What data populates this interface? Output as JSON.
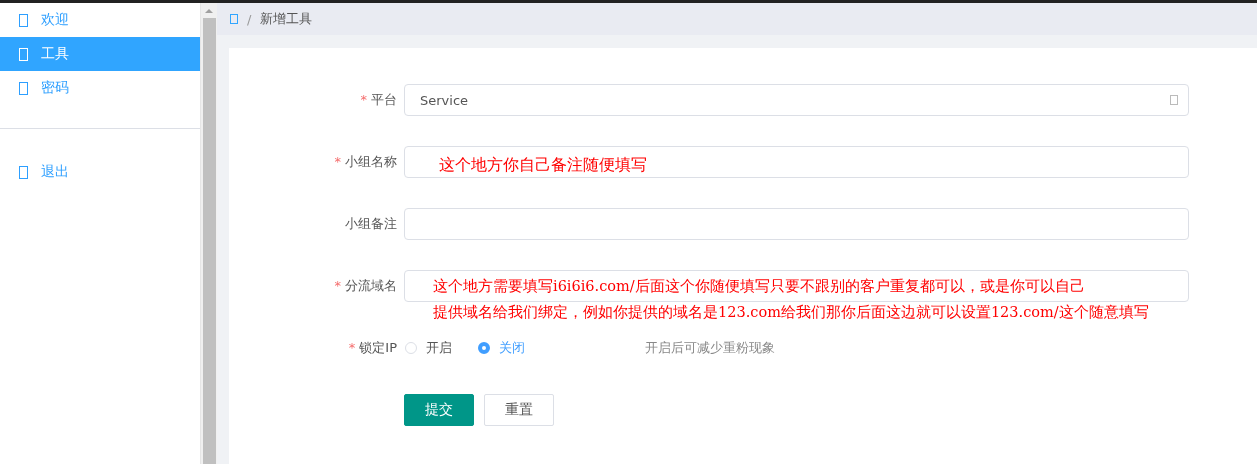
{
  "sidebar": {
    "items": [
      {
        "label": "欢迎",
        "selected": false
      },
      {
        "label": "工具",
        "selected": true
      },
      {
        "label": "密码",
        "selected": false
      }
    ],
    "logout": "退出"
  },
  "breadcrumb": {
    "separator": "/",
    "current": "新增工具"
  },
  "form": {
    "required_mark": "*",
    "fields": [
      {
        "kind": "select",
        "label": "平台",
        "required": true,
        "value": "Service"
      },
      {
        "kind": "text",
        "label": "小组名称",
        "required": true
      },
      {
        "kind": "text",
        "label": "小组备注",
        "required": false
      },
      {
        "kind": "text",
        "label": "分流域名",
        "required": true
      },
      {
        "kind": "radio",
        "label": "锁定IP",
        "required": true,
        "options": [
          {
            "label": "开启",
            "selected": false
          },
          {
            "label": "关闭",
            "selected": true
          }
        ],
        "hint": "开启后可减少重粉现象"
      }
    ],
    "buttons": [
      {
        "label": "提交",
        "kind": "primary"
      },
      {
        "label": "重置",
        "kind": "default"
      }
    ]
  },
  "annotations": [
    "这个地方你自己备注随便填写",
    "这个地方需要填写i6i6i6.com/后面这个你随便填写只要不跟别的客户重复都可以，或是你可以自己",
    "提供域名给我们绑定，例如你提供的域名是123.com给我们那你后面这边就可以设置123.com/这个随意填写"
  ]
}
